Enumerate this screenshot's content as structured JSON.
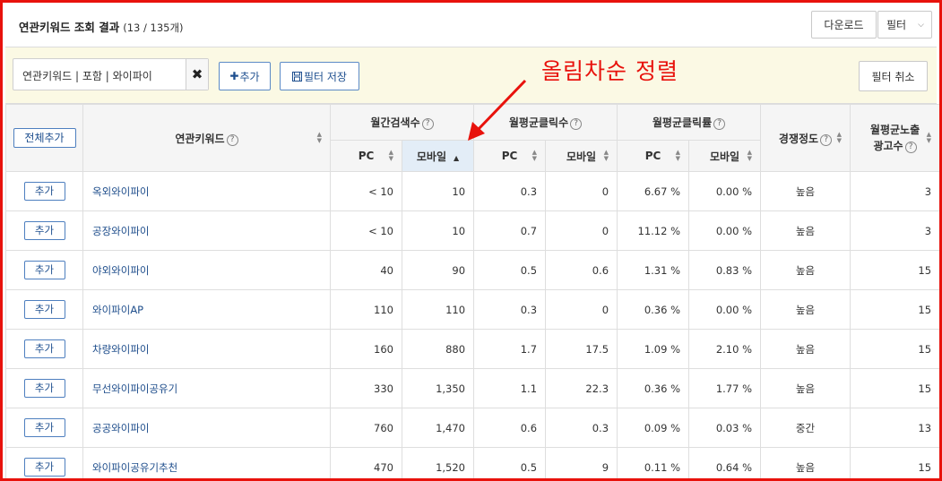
{
  "header": {
    "title": "연관키워드 조회 결과",
    "count": "(13 / 135개)",
    "download_label": "다운로드",
    "filter_label": "필터"
  },
  "filter_bar": {
    "chip_text": "연관키워드 | 포함 | 와이파이",
    "add_label": "추가",
    "save_label": "필터 저장",
    "cancel_label": "필터 취소"
  },
  "annotation": {
    "text": "올림차순 정렬",
    "color": "#e8120c"
  },
  "table": {
    "add_all_label": "전체추가",
    "col_keyword": "연관키워드",
    "grp_search": "월간검색수",
    "grp_clicks": "월평균클릭수",
    "grp_ctr": "월평균클릭률",
    "col_competition": "경쟁정도",
    "col_ads_line1": "월평균노출",
    "col_ads_line2": "광고수",
    "sub_pc": "PC",
    "sub_mobile": "모바일",
    "help_icon": "?",
    "row_add_label": "추가",
    "rows": [
      {
        "keyword": "옥외와이파이",
        "search_pc": "< 10",
        "search_mobile": "10",
        "click_pc": "0.3",
        "click_mobile": "0",
        "ctr_pc": "6.67 %",
        "ctr_mobile": "0.00 %",
        "competition": "높음",
        "ads": "3"
      },
      {
        "keyword": "공장와이파이",
        "search_pc": "< 10",
        "search_mobile": "10",
        "click_pc": "0.7",
        "click_mobile": "0",
        "ctr_pc": "11.12 %",
        "ctr_mobile": "0.00 %",
        "competition": "높음",
        "ads": "3"
      },
      {
        "keyword": "야외와이파이",
        "search_pc": "40",
        "search_mobile": "90",
        "click_pc": "0.5",
        "click_mobile": "0.6",
        "ctr_pc": "1.31 %",
        "ctr_mobile": "0.83 %",
        "competition": "높음",
        "ads": "15"
      },
      {
        "keyword": "와이파이AP",
        "search_pc": "110",
        "search_mobile": "110",
        "click_pc": "0.3",
        "click_mobile": "0",
        "ctr_pc": "0.36 %",
        "ctr_mobile": "0.00 %",
        "competition": "높음",
        "ads": "15"
      },
      {
        "keyword": "차량와이파이",
        "search_pc": "160",
        "search_mobile": "880",
        "click_pc": "1.7",
        "click_mobile": "17.5",
        "ctr_pc": "1.09 %",
        "ctr_mobile": "2.10 %",
        "competition": "높음",
        "ads": "15"
      },
      {
        "keyword": "무선와이파이공유기",
        "search_pc": "330",
        "search_mobile": "1,350",
        "click_pc": "1.1",
        "click_mobile": "22.3",
        "ctr_pc": "0.36 %",
        "ctr_mobile": "1.77 %",
        "competition": "높음",
        "ads": "15"
      },
      {
        "keyword": "공공와이파이",
        "search_pc": "760",
        "search_mobile": "1,470",
        "click_pc": "0.6",
        "click_mobile": "0.3",
        "ctr_pc": "0.09 %",
        "ctr_mobile": "0.03 %",
        "competition": "중간",
        "ads": "13"
      },
      {
        "keyword": "와이파이공유기추천",
        "search_pc": "470",
        "search_mobile": "1,520",
        "click_pc": "0.5",
        "click_mobile": "9",
        "ctr_pc": "0.11 %",
        "ctr_mobile": "0.64 %",
        "competition": "높음",
        "ads": "15"
      }
    ]
  }
}
